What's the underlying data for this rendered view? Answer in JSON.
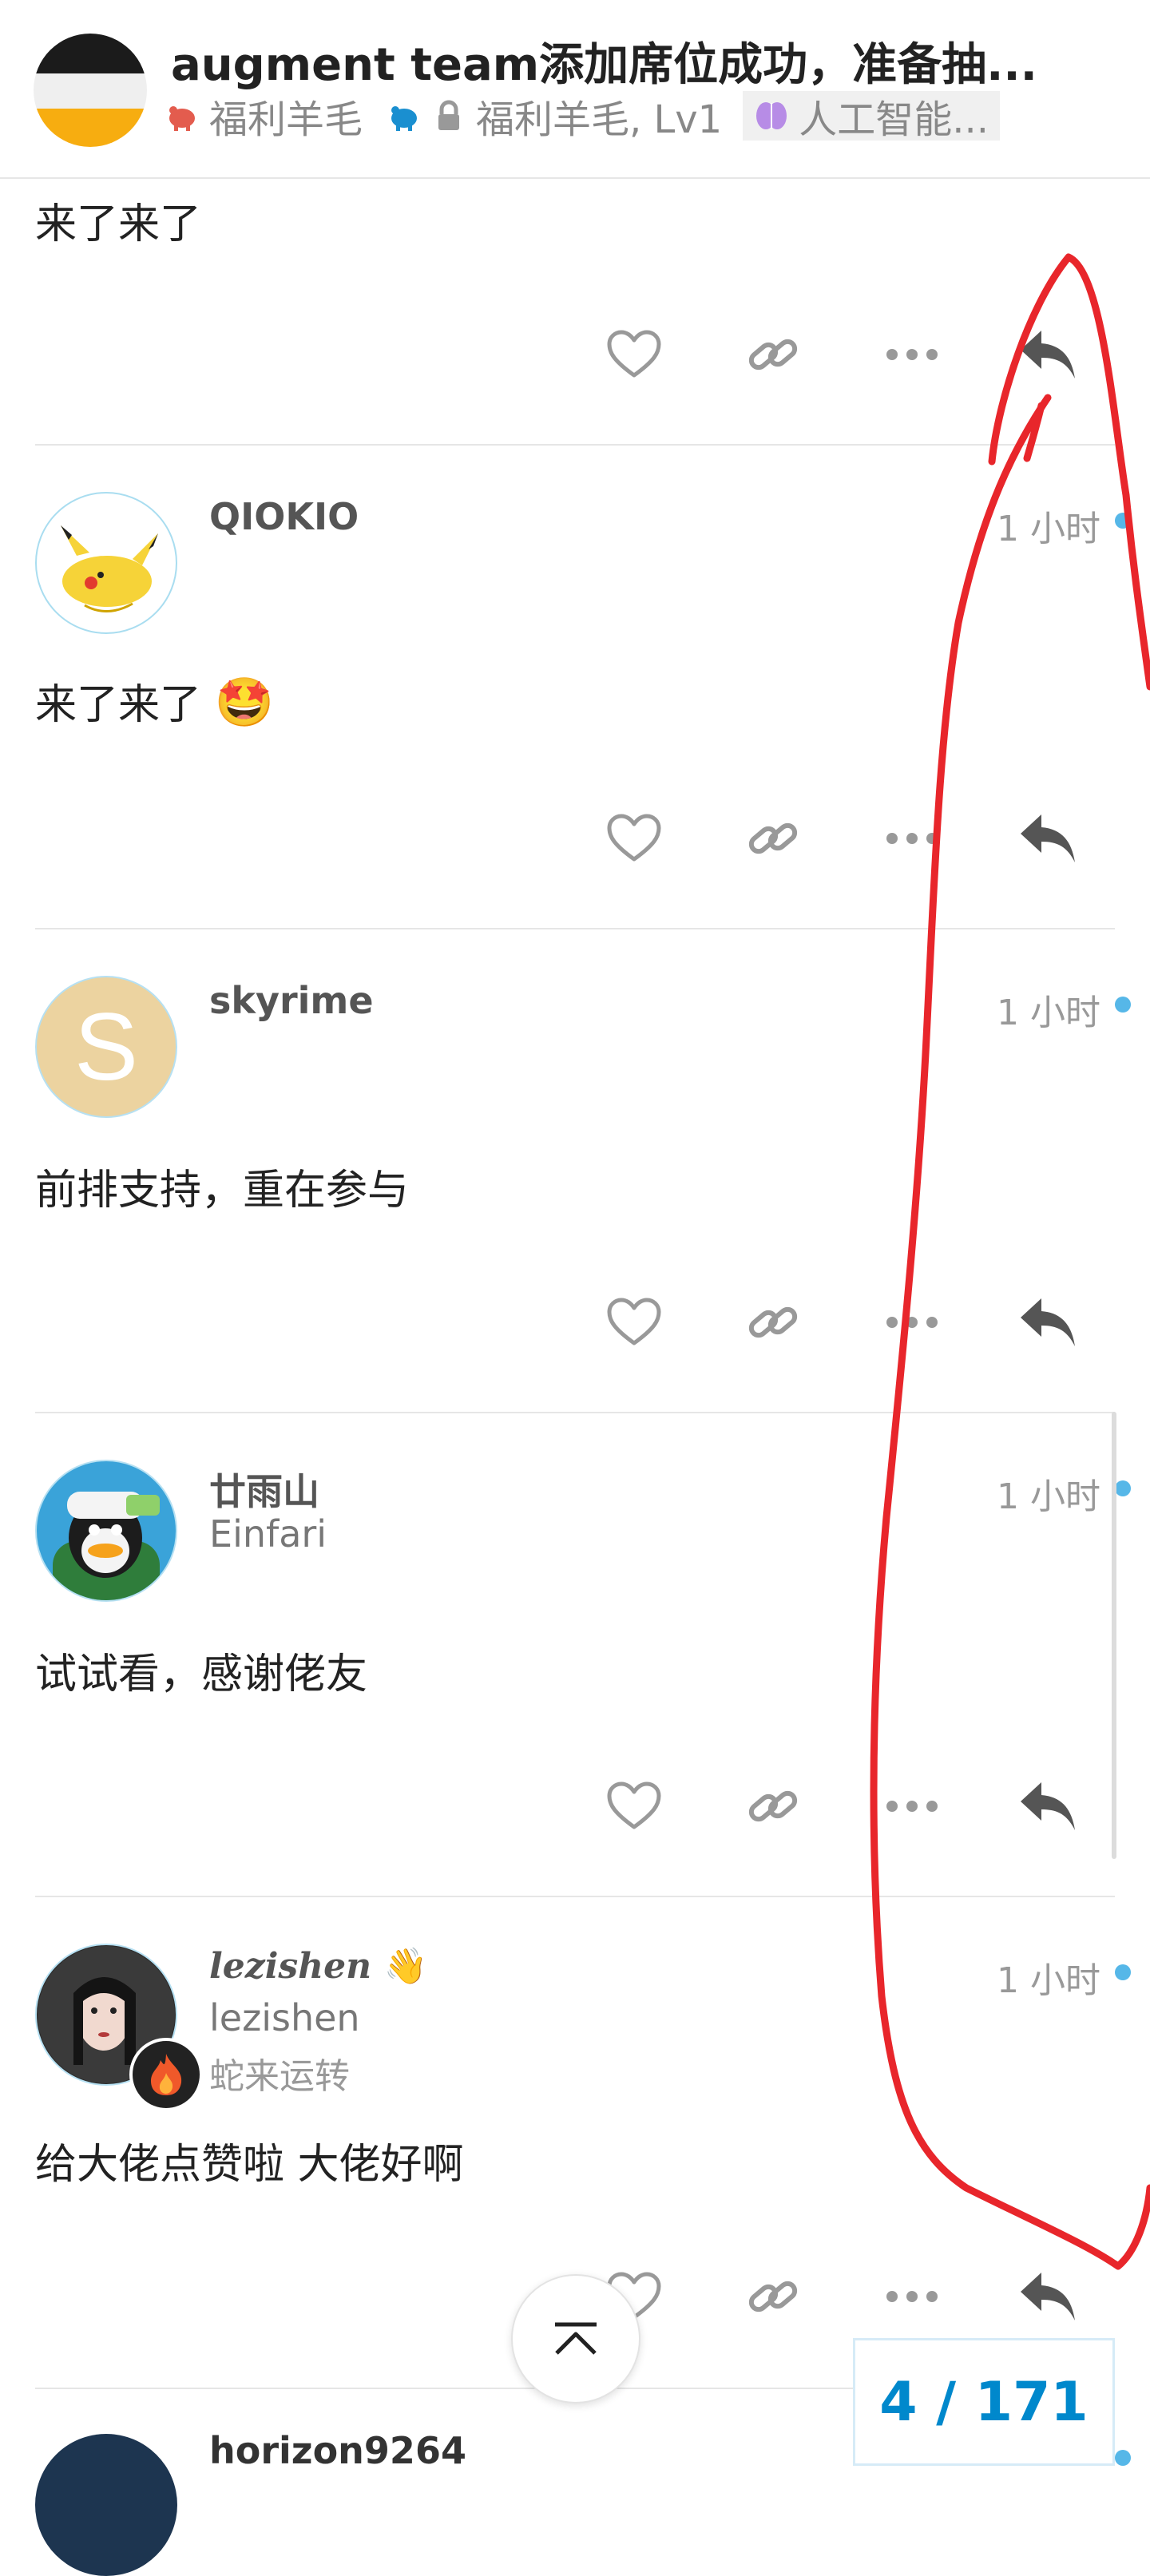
{
  "header": {
    "title": "augment team添加席位成功，准备抽...",
    "category_parent": "福利羊毛",
    "category_child": "福利羊毛, Lv1",
    "tag": "人工智能..."
  },
  "posts": [
    {
      "body": "来了来了"
    },
    {
      "username": "QIOKIO",
      "time": "1 小时",
      "body": "来了来了",
      "emoji": "🤩"
    },
    {
      "username": "skyrime",
      "avatar_letter": "S",
      "time": "1 小时",
      "body": "前排支持，重在参与"
    },
    {
      "username": "廿雨山",
      "display_name": "Einfari",
      "time": "1 小时",
      "body": "试试看，感谢佬友"
    },
    {
      "username": "lezishen",
      "username_emoji": "👋",
      "display_name": "lezishen",
      "title": "蛇来运转",
      "time": "1 小时",
      "body": "给大佬点赞啦 大佬好啊"
    },
    {
      "username": "horizon9264"
    }
  ],
  "progress": "4 / 171",
  "icons": {
    "like": "heart-icon",
    "link": "link-icon",
    "more": "ellipsis-icon",
    "reply": "reply-icon",
    "back_top": "chevron-up-icon"
  },
  "colors": {
    "accent": "#0088cc",
    "annotation": "#e8262b",
    "new_dot": "#56b7e8"
  }
}
